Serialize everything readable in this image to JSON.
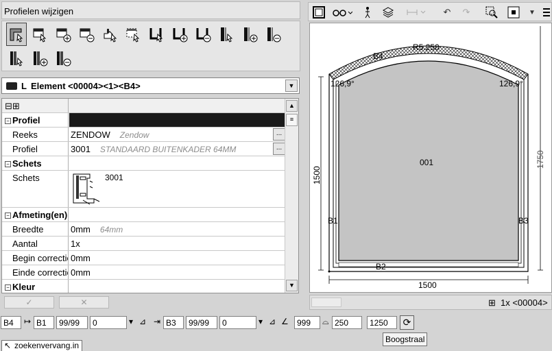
{
  "panel_title": "Profielen wijzigen",
  "toolbar_icons": [
    "profile-select-icon",
    "profile-edit-icon",
    "profile-add-icon",
    "profile-remove-icon",
    "profile-arrow-icon",
    "profile-dotted-icon",
    "frame-select-icon",
    "frame-add-icon",
    "frame-remove-icon",
    "bar-select-icon",
    "bar-add-icon",
    "bar-remove-icon",
    "double-bar-select-icon",
    "double-bar-add-icon",
    "double-bar-remove-icon"
  ],
  "element_selector": {
    "label": "Element <00004><1><B4>",
    "color": "#222222"
  },
  "grid": {
    "header_glyphs": "⊟⊞",
    "rows": [
      {
        "key": "Profiel",
        "value": "",
        "sub": "",
        "section": true
      },
      {
        "key": "Reeks",
        "value": "ZENDOW",
        "sub": "Zendow",
        "ellipsis": "..."
      },
      {
        "key": "Profiel",
        "value": "3001",
        "sub": "STANDAARD BUITENKADER 64MM",
        "ellipsis": "..."
      },
      {
        "key": "Schets",
        "value": "",
        "sub": "",
        "section": true
      },
      {
        "key": "Schets",
        "value": "3001",
        "sub": ""
      },
      {
        "key": "Afmeting(en)",
        "value": "",
        "sub": "",
        "section": true
      },
      {
        "key": "Breedte",
        "value": "0mm",
        "sub": "64mm"
      },
      {
        "key": "Aantal",
        "value": "1x",
        "sub": ""
      },
      {
        "key": "Begin correctie",
        "value": "0mm",
        "sub": ""
      },
      {
        "key": "Einde correctie",
        "value": "0mm",
        "sub": ""
      },
      {
        "key": "Kleur",
        "value": "",
        "sub": "",
        "section": true
      }
    ]
  },
  "bottom_buttons": {
    "ok": "✓",
    "cancel": "✕"
  },
  "drawing": {
    "arc_label": "R5.250",
    "top_profile": "B4",
    "left_angle": "126,9°",
    "right_angle": "126,9°",
    "center_label": "001",
    "left_profile": "B1",
    "right_profile": "B3",
    "bottom_profile": "B2",
    "left_height": "1500",
    "right_height": "1750",
    "bottom_width": "1500"
  },
  "right_status": "1x <00004>",
  "bottom_bar": {
    "profile": "B4",
    "start_profile": "B1",
    "start_ratio": "99/99",
    "start_value": "0",
    "end_profile": "B3",
    "end_ratio": "99/99",
    "end_value": "0",
    "angle": "999",
    "arc": "250",
    "height": "1250"
  },
  "tooltip": "Boogstraal",
  "tab_label": "zoekenvervang.in"
}
